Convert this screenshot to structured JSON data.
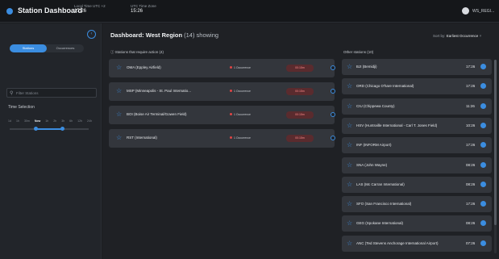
{
  "header": {
    "app_title": "Station Dashboard",
    "local_time_label": "Local Time UTC +2",
    "local_time": "17:26",
    "utc_label": "UTC Time Zone",
    "utc_time": "15:26",
    "user": "WS_REGI..."
  },
  "sidebar": {
    "tabs": [
      "Stations",
      "Occurrences"
    ],
    "filter_placeholder": "Filter Stations",
    "time_selection_title": "Time Selection",
    "time_ticks": [
      "1d",
      "1h",
      "30m",
      "Now",
      "1h",
      "2h",
      "3h",
      "6h",
      "12h",
      "24h"
    ],
    "range_start_fraction": 0.33,
    "range_end_fraction": 0.67
  },
  "main": {
    "title_bold": "Dashboard: West Region",
    "title_rest": " (14) showing",
    "sort_label": "Sort by:",
    "sort_value": "Earliest Occurrence",
    "action_title": "Stations that require action (4)",
    "other_title": "Other stations (10)",
    "action_stations": [
      {
        "name": "OMA (Eppley Airfield)",
        "badge": "1 Occurrence",
        "status": "00:15m"
      },
      {
        "name": "MSP (Minneapolis - St. Paul Internatio...",
        "badge": "1 Occurrence",
        "status": "00:15m"
      },
      {
        "name": "BOI (Boise Air Terminal/Gowen Field)",
        "badge": "1 Occurrence",
        "status": "00:15m"
      },
      {
        "name": "RST (International)",
        "badge": "1 Occurrence",
        "status": "00:15m"
      }
    ],
    "other_stations": [
      {
        "name": "BJI (Bemidji)",
        "time": "17:26"
      },
      {
        "name": "ORD (Chicago O'hare International)",
        "time": "17:26"
      },
      {
        "name": "CIU (Chippewa County)",
        "time": "11:26"
      },
      {
        "name": "HSV (Huntsville International - Carl T. Jones Field)",
        "time": "10:26"
      },
      {
        "name": "INF (INFORM Airport)",
        "time": "17:26"
      },
      {
        "name": "SNA (John Wayne)",
        "time": "08:26"
      },
      {
        "name": "LAS (Mc Carran International)",
        "time": "08:26"
      },
      {
        "name": "SFO (San Francisco International)",
        "time": "17:26"
      },
      {
        "name": "GEG (Spokane International)",
        "time": "08:26"
      },
      {
        "name": "ANC (Ted Stevens Anchorage International Airport)",
        "time": "07:26"
      }
    ]
  },
  "colors": {
    "accent": "#3b8de0",
    "alert": "#e04646"
  },
  "icons": [
    "logo-icon",
    "avatar-icon",
    "collapse-icon",
    "search-icon",
    "star-icon",
    "info-icon"
  ]
}
